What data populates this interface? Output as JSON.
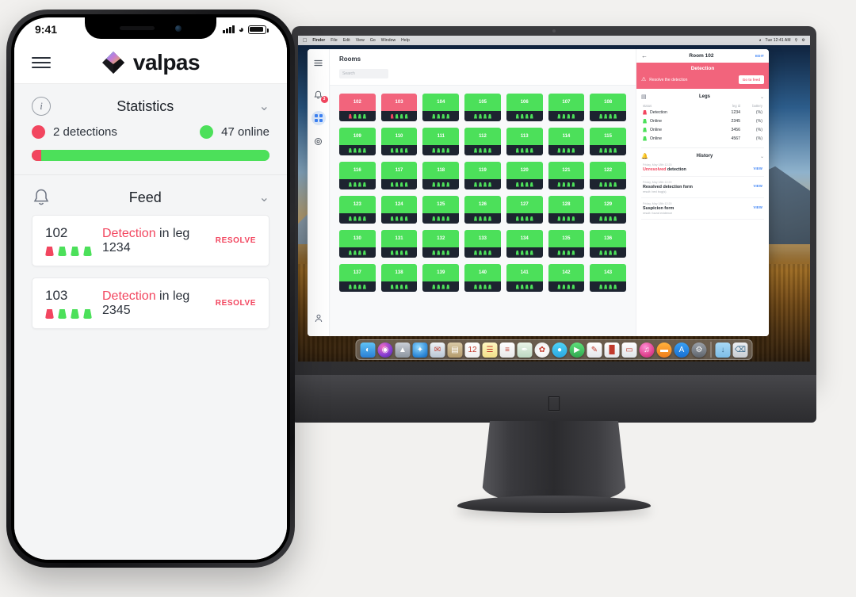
{
  "phone": {
    "status_bar": {
      "time": "9:41",
      "signal_icon": "cellular-bars-icon",
      "wifi_icon": "wifi-icon",
      "battery_icon": "battery-icon"
    },
    "header": {
      "menu_icon": "hamburger-menu-icon",
      "logo_icon": "valpas-diamond-logo",
      "brand": "valpas"
    },
    "statistics": {
      "info_icon": "info-circle-icon",
      "title": "Statistics",
      "collapse_icon": "chevron-down-icon",
      "detections_label": "2 detections",
      "online_label": "47 online",
      "detections_count": 2,
      "online_count": 47,
      "bar_red_pct": 4,
      "bar_green_pct": 96
    },
    "feed": {
      "bell_icon": "bell-icon",
      "title": "Feed",
      "collapse_icon": "chevron-down-icon",
      "items": [
        {
          "room": "102",
          "event": "Detection",
          "suffix": " in leg 1234",
          "action": "RESOLVE",
          "legs": [
            "red",
            "green",
            "green",
            "green"
          ]
        },
        {
          "room": "103",
          "event": "Detection",
          "suffix": " in leg 2345",
          "action": "RESOLVE",
          "legs": [
            "red",
            "green",
            "green",
            "green"
          ]
        }
      ]
    }
  },
  "desktop": {
    "menubar": {
      "apple_icon": "apple-menu-icon",
      "items": [
        "Finder",
        "File",
        "Edit",
        "View",
        "Go",
        "Window",
        "Help"
      ],
      "right": {
        "wifi_icon": "wifi-icon",
        "time": "Tue 12:41 AM",
        "search_icon": "spotlight-icon",
        "control_icon": "control-center-icon",
        "list_icon": "siri-icon"
      }
    },
    "dock": {
      "apps": [
        {
          "name": "finder-icon",
          "glyph": "◐",
          "color": "linear-gradient(180deg,#5fc2f5 0%,#2a7fd4 100%)"
        },
        {
          "name": "siri-icon",
          "glyph": "◉",
          "color": "radial-gradient(circle at 35% 30%, #f06ec0 0%, #8b3fd4 55%, #4a2a9c 100%)"
        },
        {
          "name": "launchpad-icon",
          "glyph": "▲",
          "color": "linear-gradient(180deg,#c9ced6 0%,#8c949f 100%)"
        },
        {
          "name": "safari-icon",
          "glyph": "✦",
          "color": "radial-gradient(circle at 40% 30%, #8fd8ff 0%, #2b86d6 70%, #1b63ab 100%)"
        },
        {
          "name": "mail-icon",
          "glyph": "✉",
          "color": "linear-gradient(180deg,#eef3f7 0%,#b9c6d4 100%)"
        },
        {
          "name": "contacts-icon",
          "glyph": "▤",
          "color": "linear-gradient(180deg,#d9c9a6 0%,#b39b6c 100%)"
        },
        {
          "name": "calendar-icon",
          "glyph": "12",
          "color": "linear-gradient(180deg,#ffffff 0%,#efefef 100%)"
        },
        {
          "name": "notes-icon",
          "glyph": "☰",
          "color": "linear-gradient(180deg,#fff7c2 0%,#f2e08a 100%)"
        },
        {
          "name": "reminders-icon",
          "glyph": "≡",
          "color": "linear-gradient(180deg,#ffffff 0%,#e8e8e8 100%)"
        },
        {
          "name": "maps-icon",
          "glyph": "✒",
          "color": "linear-gradient(180deg,#eaf4e8 0%,#bcd8c2 100%)"
        },
        {
          "name": "photos-icon",
          "glyph": "✿",
          "color": "radial-gradient(circle at 50% 50%, #ffffff 0%, #f3f3f3 60%, #e2e2e2 100%)"
        },
        {
          "name": "messages-icon",
          "glyph": "●",
          "color": "linear-gradient(180deg,#4fd3f7 0%,#2aa7e0 100%)"
        },
        {
          "name": "facetime-icon",
          "glyph": "▶",
          "color": "linear-gradient(180deg,#5ede7a 0%,#2fa94f 100%)"
        },
        {
          "name": "pages-icon",
          "glyph": "✎",
          "color": "linear-gradient(180deg,#ffffff 0%,#e3e6ea 100%)"
        },
        {
          "name": "numbers-icon",
          "glyph": "█",
          "color": "linear-gradient(180deg,#ffffff 0%,#e3e6ea 100%)"
        },
        {
          "name": "keynote-icon",
          "glyph": "▭",
          "color": "linear-gradient(180deg,#ffffff 0%,#dfe3e8 100%)"
        },
        {
          "name": "itunes-icon",
          "glyph": "♫",
          "color": "radial-gradient(circle at 40% 30%, #ff8fd6 0%, #e0438f 60%, #b52d77 100%)"
        },
        {
          "name": "ibooks-icon",
          "glyph": "▬",
          "color": "linear-gradient(180deg,#ffb13d 0%,#ef7d1a 100%)"
        },
        {
          "name": "appstore-icon",
          "glyph": "A",
          "color": "linear-gradient(180deg,#3aa0f5 0%,#176fd1 100%)"
        },
        {
          "name": "system-preferences-icon",
          "glyph": "⚙",
          "color": "linear-gradient(180deg,#9aa0a8 0%,#5e646c 100%)"
        }
      ],
      "right": [
        {
          "name": "downloads-folder-icon",
          "glyph": "↓",
          "color": "linear-gradient(180deg,#a8d9f5 0%,#7dbde6 100%)"
        },
        {
          "name": "trash-icon",
          "glyph": "⌫",
          "color": "linear-gradient(180deg,#eceff2 0%,#c8cdd3 100%)"
        }
      ]
    },
    "app": {
      "rail": {
        "menu_icon": "hamburger-menu-icon",
        "notifications_icon": "bell-icon",
        "notifications_badge": "3",
        "grid_icon": "grid-apps-icon",
        "settings_icon": "gear-icon",
        "account_icon": "user-account-icon"
      },
      "rooms": {
        "title": "Rooms",
        "search_placeholder": "Search",
        "rooms": [
          {
            "number": "102",
            "state": "alert",
            "legs": [
              "red",
              "green",
              "green",
              "green"
            ]
          },
          {
            "number": "103",
            "state": "alert",
            "legs": [
              "red",
              "green",
              "green",
              "green"
            ]
          },
          {
            "number": "104",
            "state": "ok",
            "legs": [
              "green",
              "green",
              "green",
              "green"
            ]
          },
          {
            "number": "105",
            "state": "ok",
            "legs": [
              "green",
              "green",
              "green",
              "green"
            ]
          },
          {
            "number": "106",
            "state": "ok",
            "legs": [
              "green",
              "green",
              "green",
              "green"
            ]
          },
          {
            "number": "107",
            "state": "ok",
            "legs": [
              "green",
              "green",
              "green",
              "green"
            ]
          },
          {
            "number": "108",
            "state": "ok",
            "legs": [
              "green",
              "green",
              "green",
              "green"
            ]
          },
          {
            "number": "109",
            "state": "ok",
            "legs": [
              "green",
              "green",
              "green",
              "green"
            ]
          },
          {
            "number": "110",
            "state": "ok",
            "legs": [
              "green",
              "green",
              "green",
              "green"
            ]
          },
          {
            "number": "111",
            "state": "ok",
            "legs": [
              "green",
              "green",
              "green",
              "green"
            ]
          },
          {
            "number": "112",
            "state": "ok",
            "legs": [
              "green",
              "green",
              "green",
              "green"
            ]
          },
          {
            "number": "113",
            "state": "ok",
            "legs": [
              "green",
              "green",
              "green",
              "green"
            ]
          },
          {
            "number": "114",
            "state": "ok",
            "legs": [
              "green",
              "green",
              "green",
              "green"
            ]
          },
          {
            "number": "115",
            "state": "ok",
            "legs": [
              "green",
              "green",
              "green",
              "green"
            ]
          },
          {
            "number": "116",
            "state": "ok",
            "legs": [
              "green",
              "green",
              "green",
              "green"
            ]
          },
          {
            "number": "117",
            "state": "ok",
            "legs": [
              "green",
              "green",
              "green",
              "green"
            ]
          },
          {
            "number": "118",
            "state": "ok",
            "legs": [
              "green",
              "green",
              "green",
              "green"
            ]
          },
          {
            "number": "119",
            "state": "ok",
            "legs": [
              "green",
              "green",
              "green",
              "green"
            ]
          },
          {
            "number": "120",
            "state": "ok",
            "legs": [
              "green",
              "green",
              "green",
              "green"
            ]
          },
          {
            "number": "121",
            "state": "ok",
            "legs": [
              "green",
              "green",
              "green",
              "green"
            ]
          },
          {
            "number": "122",
            "state": "ok",
            "legs": [
              "green",
              "green",
              "green",
              "green"
            ]
          },
          {
            "number": "123",
            "state": "ok",
            "legs": [
              "green",
              "green",
              "green",
              "green"
            ]
          },
          {
            "number": "124",
            "state": "ok",
            "legs": [
              "green",
              "green",
              "green",
              "green"
            ]
          },
          {
            "number": "125",
            "state": "ok",
            "legs": [
              "green",
              "green",
              "green",
              "green"
            ]
          },
          {
            "number": "126",
            "state": "ok",
            "legs": [
              "green",
              "green",
              "green",
              "green"
            ]
          },
          {
            "number": "127",
            "state": "ok",
            "legs": [
              "green",
              "green",
              "green",
              "green"
            ]
          },
          {
            "number": "128",
            "state": "ok",
            "legs": [
              "green",
              "green",
              "green",
              "green"
            ]
          },
          {
            "number": "129",
            "state": "ok",
            "legs": [
              "green",
              "green",
              "green",
              "green"
            ]
          },
          {
            "number": "130",
            "state": "ok",
            "legs": [
              "green",
              "green",
              "green",
              "green"
            ]
          },
          {
            "number": "131",
            "state": "ok",
            "legs": [
              "green",
              "green",
              "green",
              "green"
            ]
          },
          {
            "number": "132",
            "state": "ok",
            "legs": [
              "green",
              "green",
              "green",
              "green"
            ]
          },
          {
            "number": "133",
            "state": "ok",
            "legs": [
              "green",
              "green",
              "green",
              "green"
            ]
          },
          {
            "number": "134",
            "state": "ok",
            "legs": [
              "green",
              "green",
              "green",
              "green"
            ]
          },
          {
            "number": "135",
            "state": "ok",
            "legs": [
              "green",
              "green",
              "green",
              "green"
            ]
          },
          {
            "number": "136",
            "state": "ok",
            "legs": [
              "green",
              "green",
              "green",
              "green"
            ]
          },
          {
            "number": "137",
            "state": "ok",
            "legs": [
              "green",
              "green",
              "green",
              "green"
            ]
          },
          {
            "number": "138",
            "state": "ok",
            "legs": [
              "green",
              "green",
              "green",
              "green"
            ]
          },
          {
            "number": "139",
            "state": "ok",
            "legs": [
              "green",
              "green",
              "green",
              "green"
            ]
          },
          {
            "number": "140",
            "state": "ok",
            "legs": [
              "green",
              "green",
              "green",
              "green"
            ]
          },
          {
            "number": "141",
            "state": "ok",
            "legs": [
              "green",
              "green",
              "green",
              "green"
            ]
          },
          {
            "number": "142",
            "state": "ok",
            "legs": [
              "green",
              "green",
              "green",
              "green"
            ]
          },
          {
            "number": "143",
            "state": "ok",
            "legs": [
              "green",
              "green",
              "green",
              "green"
            ]
          }
        ]
      },
      "detail": {
        "back_icon": "arrow-left-icon",
        "title": "Room 102",
        "edit_label": "EDIT",
        "banner": {
          "title": "Detection",
          "warning_icon": "warning-triangle-icon",
          "message": "Resolve the detection",
          "button": "Go to feed"
        },
        "legs_section": {
          "icon": "bed-icon",
          "title": "Legs",
          "collapse_icon": "chevron-down-icon",
          "columns": [
            "status",
            "leg id",
            "battery"
          ],
          "rows": [
            {
              "status": "Detection",
              "state": "red",
              "id": "1234",
              "battery": "(%)"
            },
            {
              "status": "Online",
              "state": "green",
              "id": "2345",
              "battery": "(%)"
            },
            {
              "status": "Online",
              "state": "green",
              "id": "3456",
              "battery": "(%)"
            },
            {
              "status": "Online",
              "state": "green",
              "id": "4567",
              "battery": "(%)"
            }
          ]
        },
        "history_section": {
          "icon": "bell-icon",
          "title": "History",
          "collapse_icon": "chevron-down-icon",
          "items": [
            {
              "time": "Friday, May 18th 12:20",
              "title_warn": "Unresolved",
              "title_rest": " detection",
              "result": "",
              "view": "VIEW"
            },
            {
              "time": "Friday, May 18th 12:20",
              "title_warn": "",
              "title_rest": "Resolved detection form",
              "result": "result: bed bug(s)",
              "view": "VIEW"
            },
            {
              "time": "Friday, May 18th 12:20",
              "title_warn": "",
              "title_rest": "Suspicion form",
              "result": "result: found evidence",
              "view": "VIEW"
            }
          ]
        }
      }
    }
  },
  "colors": {
    "alert_red": "#f2465f",
    "banner_red": "#f2647c",
    "online_green": "#4ce05a",
    "link_blue": "#3b82f6",
    "page_bg": "#f2f1ef"
  }
}
